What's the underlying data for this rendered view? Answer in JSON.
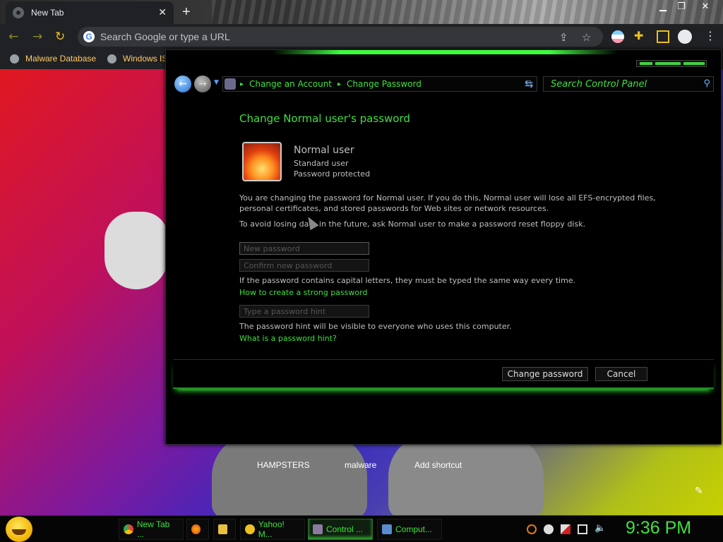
{
  "browser": {
    "tab_title": "New Tab",
    "tab_close": "✕",
    "new_tab": "+",
    "omnibox_placeholder": "Search Google or type a URL",
    "bookmarks": [
      {
        "label": "Malware Database"
      },
      {
        "label": "Windows IS"
      }
    ]
  },
  "page": {
    "shortcuts": [
      "HAMPSTERS",
      "malware",
      "Add shortcut"
    ]
  },
  "control_panel": {
    "breadcrumbs": [
      "Change an Account",
      "Change Password"
    ],
    "search_placeholder": "Search Control Panel",
    "title": "Change Normal user's password",
    "user": {
      "name": "Normal user",
      "type": "Standard user",
      "protection": "Password protected"
    },
    "warning_text": "You are changing the password for Normal user.  If you do this, Normal user will lose all EFS-encrypted files, personal certificates, and stored passwords for Web sites or network resources.",
    "floppy_text": "To avoid losing data in the future, ask Normal user to make a password reset floppy disk.",
    "new_password_placeholder": "New password",
    "confirm_password_placeholder": "Confirm new password",
    "caps_text": "If the password contains capital letters, they must be typed the same way every time.",
    "strong_link": "How to create a strong password",
    "hint_placeholder": "Type a password hint",
    "hint_text": "The password hint will be visible to everyone who uses this computer.",
    "hint_link": "What is a password hint?",
    "change_button": "Change password",
    "cancel_button": "Cancel"
  },
  "taskbar": {
    "tasks": [
      "New Tab ...",
      "Yahoo! M...",
      "Control ...",
      "Comput..."
    ],
    "clock": "9:36 PM"
  },
  "colors": {
    "accent_green": "#3fe03f",
    "bookmark_yellow": "#ffcc66"
  }
}
